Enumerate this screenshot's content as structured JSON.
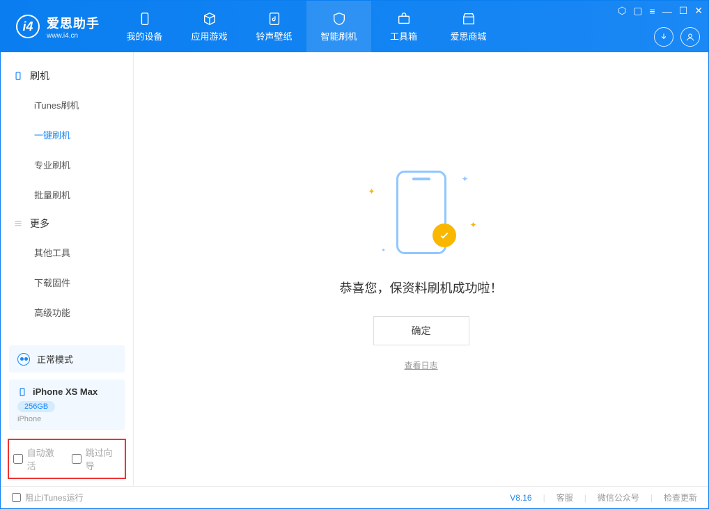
{
  "brand": {
    "name": "爱思助手",
    "site": "www.i4.cn"
  },
  "nav": {
    "items": [
      {
        "label": "我的设备"
      },
      {
        "label": "应用游戏"
      },
      {
        "label": "铃声壁纸"
      },
      {
        "label": "智能刷机"
      },
      {
        "label": "工具箱"
      },
      {
        "label": "爱思商城"
      }
    ]
  },
  "sidebar": {
    "group1": {
      "title": "刷机",
      "items": [
        "iTunes刷机",
        "一键刷机",
        "专业刷机",
        "批量刷机"
      ]
    },
    "group2": {
      "title": "更多",
      "items": [
        "其他工具",
        "下载固件",
        "高级功能"
      ]
    }
  },
  "device": {
    "mode": "正常模式",
    "name": "iPhone XS Max",
    "storage": "256GB",
    "type": "iPhone"
  },
  "checks": {
    "auto_activate": "自动激活",
    "skip_guide": "跳过向导"
  },
  "result": {
    "message": "恭喜您，保资料刷机成功啦！",
    "ok": "确定",
    "log": "查看日志"
  },
  "status": {
    "block_itunes": "阻止iTunes运行",
    "version": "V8.16",
    "support": "客服",
    "wechat": "微信公众号",
    "update": "检查更新"
  }
}
